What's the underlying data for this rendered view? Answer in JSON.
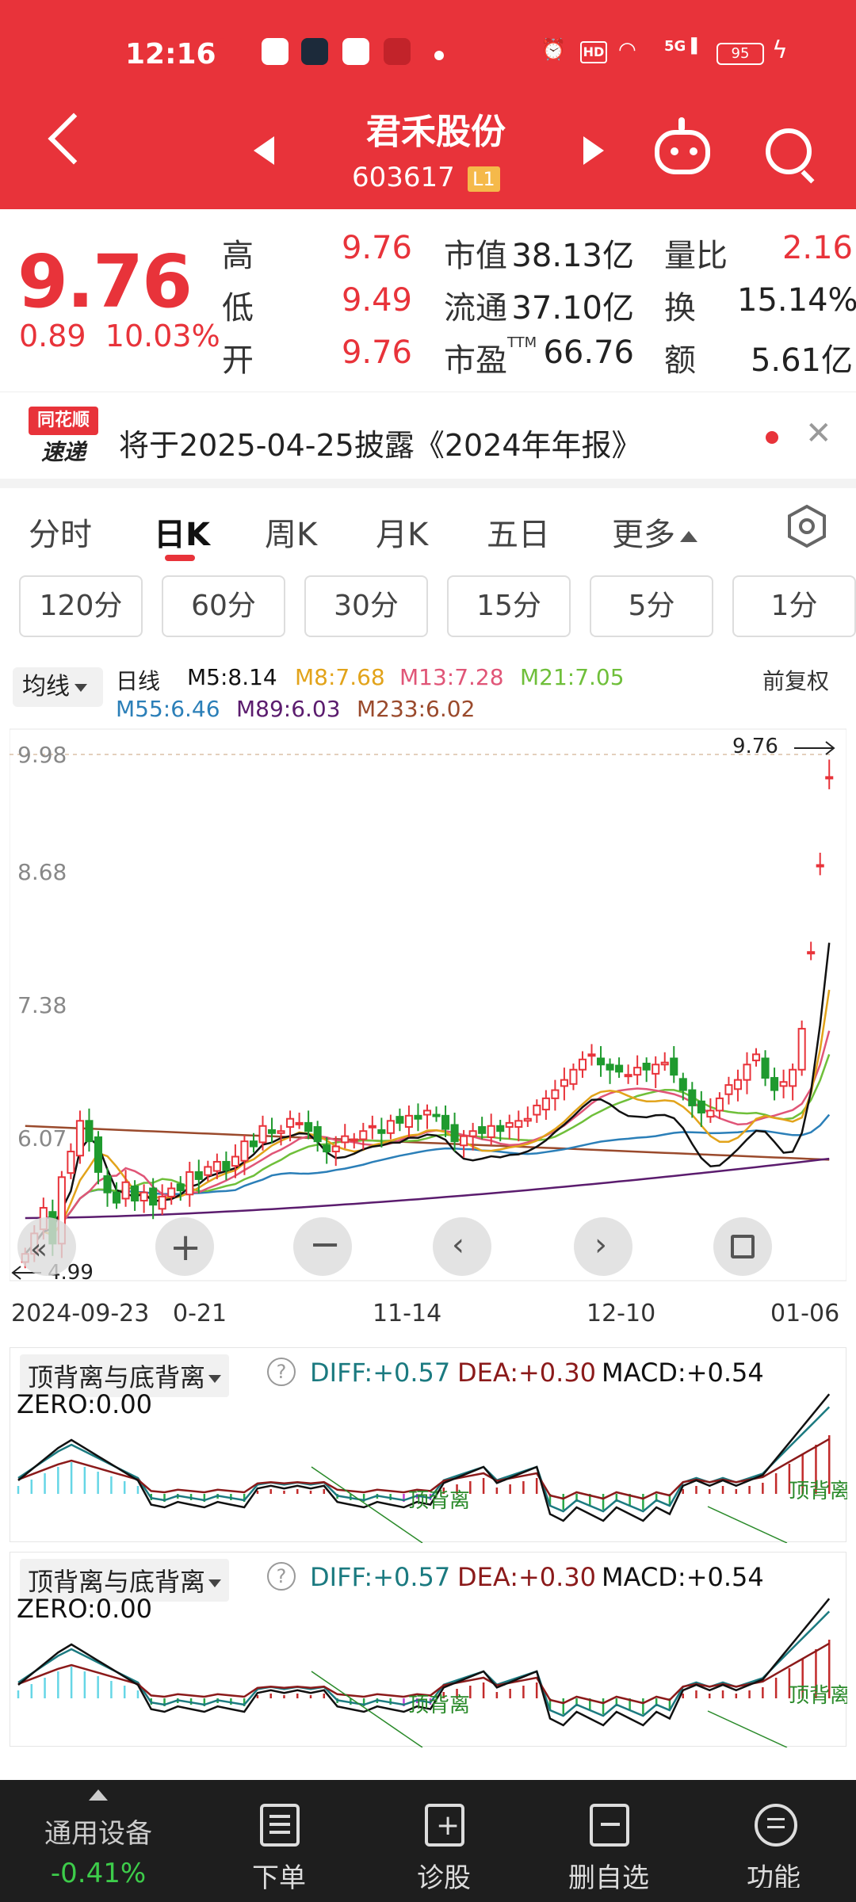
{
  "status": {
    "time": "12:16",
    "battery": "95"
  },
  "header": {
    "name": "君禾股份",
    "code": "603617",
    "level": "L1"
  },
  "quote": {
    "price": "9.76",
    "change": "0.89",
    "change_pct": "10.03%",
    "high_label": "高",
    "high": "9.76",
    "low_label": "低",
    "low": "9.49",
    "open_label": "开",
    "open": "9.76",
    "mktcap_label": "市值",
    "mktcap": "38.13亿",
    "float_label": "流通",
    "float": "37.10亿",
    "pe_label": "市盈",
    "pe_sup": "TTM",
    "pe": "66.76",
    "volratio_label": "量比",
    "volratio": "2.16",
    "turnover_label": "换",
    "turnover": "15.14%",
    "amount_label": "额",
    "amount": "5.61亿"
  },
  "banner": {
    "logo_top": "同花顺",
    "logo_bottom": "速递",
    "text": "将于2025-04-25披露《2024年年报》"
  },
  "tabs": [
    "分时",
    "日K",
    "周K",
    "月K",
    "五日",
    "更多"
  ],
  "intervals": [
    "120分",
    "60分",
    "30分",
    "15分",
    "5分",
    "1分"
  ],
  "ma": {
    "button": "均线",
    "kind": "日线",
    "m5": "M5:8.14",
    "m8": "M8:7.68",
    "m13": "M13:7.28",
    "m21": "M21:7.05",
    "m55": "M55:6.46",
    "m89": "M89:6.03",
    "m233": "M233:6.02",
    "adjust": "前复权"
  },
  "chart_data": {
    "type": "candlestick",
    "y_ticks": [
      "9.98",
      "8.68",
      "7.38",
      "6.07"
    ],
    "ylim": [
      4.9,
      9.98
    ],
    "high_mark": "9.76",
    "low_mark": "4.99",
    "x_labels": [
      "2024-09-23",
      "0-21",
      "11-14",
      "12-10",
      "01-06"
    ],
    "ma_last": {
      "M5": 8.14,
      "M8": 7.68,
      "M13": 7.28,
      "M21": 7.05,
      "M55": 6.46,
      "M89": 6.03,
      "M233": 6.02
    },
    "colors": {
      "up": "#e8333a",
      "down": "#1f9a2e",
      "M5": "#111111",
      "M8": "#e2a31a",
      "M13": "#e05577",
      "M21": "#6fbf3a",
      "M55": "#2b7fb8",
      "M89": "#5b1c6e",
      "M233": "#9a4a2c"
    },
    "closes": [
      5.1,
      5.3,
      5.55,
      5.2,
      5.85,
      6.1,
      6.4,
      6.2,
      5.9,
      5.7,
      5.6,
      5.8,
      5.62,
      5.7,
      5.58,
      5.66,
      5.74,
      5.72,
      5.9,
      5.83,
      5.95,
      6.0,
      5.92,
      6.05,
      6.2,
      6.15,
      6.35,
      6.28,
      6.3,
      6.42,
      6.38,
      6.3,
      6.2,
      6.1,
      6.15,
      6.25,
      6.22,
      6.3,
      6.35,
      6.28,
      6.4,
      6.38,
      6.45,
      6.42,
      6.5,
      6.45,
      6.32,
      6.2,
      6.25,
      6.3,
      6.28,
      6.35,
      6.3,
      6.38,
      6.4,
      6.42,
      6.55,
      6.62,
      6.7,
      6.8,
      6.9,
      7.0,
      7.05,
      6.95,
      6.9,
      6.88,
      6.85,
      6.92,
      6.9,
      6.95,
      6.97,
      6.85,
      6.7,
      6.55,
      6.48,
      6.5,
      6.62,
      6.75,
      6.8,
      6.95,
      7.05,
      6.82,
      6.7,
      6.78,
      6.9,
      7.3,
      8.05,
      8.9,
      9.76
    ]
  },
  "macd": {
    "title": "顶背离与底背离",
    "help": "?",
    "diff": "DIFF:+0.57",
    "dea": "DEA:+0.30",
    "macd": "MACD:+0.54",
    "zero": "ZERO:0.00",
    "tag": "顶背离",
    "tag_right": "顶背离"
  },
  "bottom": {
    "ticker_name": "通用设备",
    "ticker_pct": "-0.41%",
    "order": "下单",
    "diagnose": "诊股",
    "remove": "删自选",
    "more": "功能"
  }
}
